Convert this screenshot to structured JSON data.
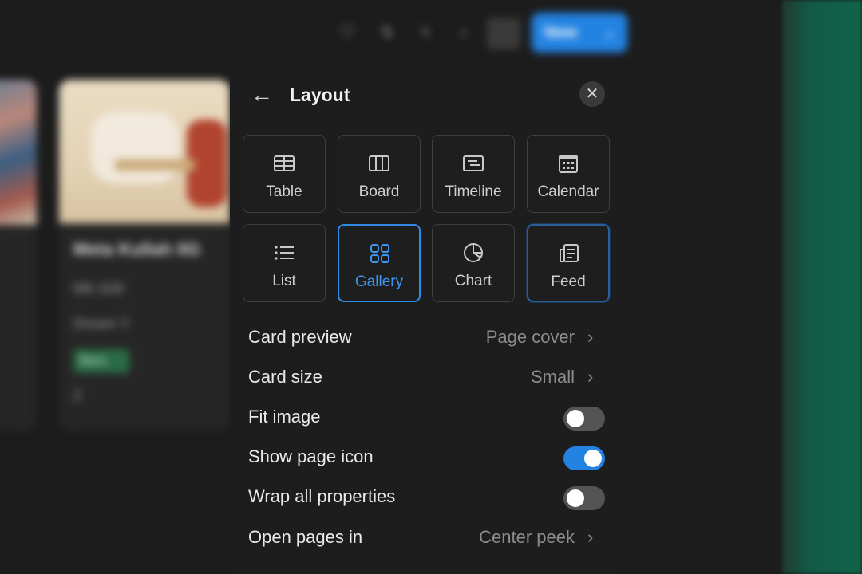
{
  "toolbar": {
    "icons": [
      "filter-icon",
      "sort-icon",
      "lightning-icon",
      "search-icon",
      "settings-icon"
    ],
    "new_button": "New",
    "accent": "#2383e2"
  },
  "background_card": {
    "title": "Meta Kullah 0G",
    "line1": "MK-026",
    "line2": "Dream Y",
    "tag": "Baru",
    "count": "2"
  },
  "panel": {
    "title": "Layout",
    "back_icon": "arrow-left-icon",
    "close_icon": "close-icon",
    "layouts": [
      {
        "label": "Table",
        "icon": "table-icon"
      },
      {
        "label": "Board",
        "icon": "board-icon"
      },
      {
        "label": "Timeline",
        "icon": "timeline-icon"
      },
      {
        "label": "Calendar",
        "icon": "calendar-icon"
      },
      {
        "label": "List",
        "icon": "list-icon"
      },
      {
        "label": "Gallery",
        "icon": "gallery-icon",
        "selected": true
      },
      {
        "label": "Chart",
        "icon": "chart-icon"
      },
      {
        "label": "Feed",
        "icon": "feed-icon"
      }
    ],
    "settings": [
      {
        "label": "Card preview",
        "value": "Page cover",
        "type": "menu"
      },
      {
        "label": "Card size",
        "value": "Small",
        "type": "menu"
      },
      {
        "label": "Fit image",
        "type": "toggle",
        "on": false
      },
      {
        "label": "Show page icon",
        "type": "toggle",
        "on": true
      },
      {
        "label": "Wrap all properties",
        "type": "toggle",
        "on": false
      },
      {
        "label": "Open pages in",
        "value": "Center peek",
        "type": "menu"
      }
    ]
  }
}
